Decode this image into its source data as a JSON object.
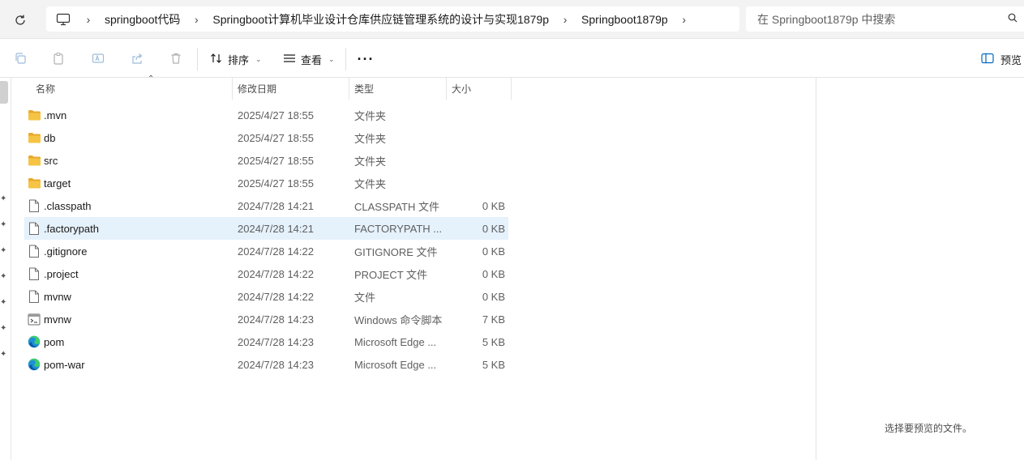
{
  "address_bar": {
    "breadcrumbs": [
      "springboot代码",
      "Springboot计算机毕业设计仓库供应链管理系统的设计与实现1879p",
      "Springboot1879p"
    ],
    "search_placeholder": "在 Springboot1879p 中搜索"
  },
  "command_bar": {
    "sort_label": "排序",
    "view_label": "查看",
    "more_label": "···",
    "preview_label": "预览"
  },
  "columns": {
    "name": "名称",
    "date": "修改日期",
    "type": "类型",
    "size": "大小"
  },
  "files": [
    {
      "name": ".mvn",
      "date": "2025/4/27 18:55",
      "type": "文件夹",
      "size": "",
      "icon": "folder-icon"
    },
    {
      "name": "db",
      "date": "2025/4/27 18:55",
      "type": "文件夹",
      "size": "",
      "icon": "folder-icon"
    },
    {
      "name": "src",
      "date": "2025/4/27 18:55",
      "type": "文件夹",
      "size": "",
      "icon": "folder-icon"
    },
    {
      "name": "target",
      "date": "2025/4/27 18:55",
      "type": "文件夹",
      "size": "",
      "icon": "folder-icon"
    },
    {
      "name": ".classpath",
      "date": "2024/7/28 14:21",
      "type": "CLASSPATH 文件",
      "size": "0 KB",
      "icon": "file-icon"
    },
    {
      "name": ".factorypath",
      "date": "2024/7/28 14:21",
      "type": "FACTORYPATH ...",
      "size": "0 KB",
      "icon": "file-icon",
      "selected": true
    },
    {
      "name": ".gitignore",
      "date": "2024/7/28 14:22",
      "type": "GITIGNORE 文件",
      "size": "0 KB",
      "icon": "file-icon"
    },
    {
      "name": ".project",
      "date": "2024/7/28 14:22",
      "type": "PROJECT 文件",
      "size": "0 KB",
      "icon": "file-icon"
    },
    {
      "name": "mvnw",
      "date": "2024/7/28 14:22",
      "type": "文件",
      "size": "0 KB",
      "icon": "file-icon"
    },
    {
      "name": "mvnw",
      "date": "2024/7/28 14:23",
      "type": "Windows 命令脚本",
      "size": "7 KB",
      "icon": "script-icon"
    },
    {
      "name": "pom",
      "date": "2024/7/28 14:23",
      "type": "Microsoft Edge ...",
      "size": "5 KB",
      "icon": "edge-icon"
    },
    {
      "name": "pom-war",
      "date": "2024/7/28 14:23",
      "type": "Microsoft Edge ...",
      "size": "5 KB",
      "icon": "edge-icon"
    }
  ],
  "preview_pane": {
    "message": "选择要预览的文件。"
  },
  "colors": {
    "selection": "#e5f1fb",
    "folder": "#f6c445",
    "accent": "#0067c0"
  }
}
